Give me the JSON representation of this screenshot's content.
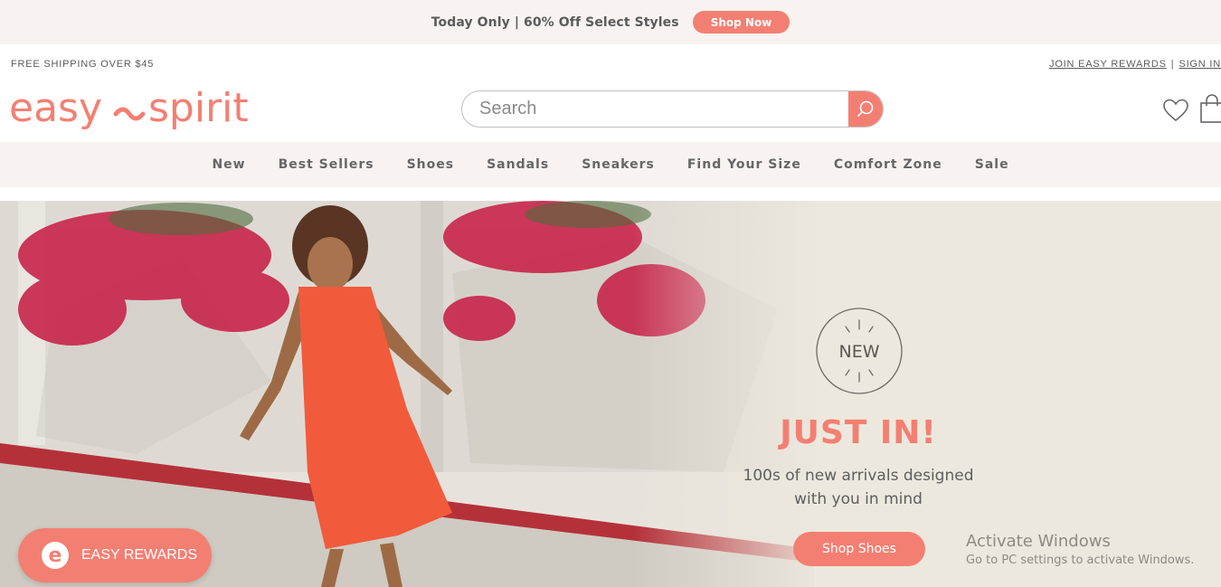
{
  "promo": {
    "text": "Today Only | 60% Off Select Styles",
    "cta": "Shop Now"
  },
  "utility": {
    "left": "FREE SHIPPING OVER $45",
    "join": "JOIN EASY REWARDS",
    "separator": "|",
    "signin": "SIGN IN"
  },
  "logo": {
    "text_left": "easy",
    "text_right": "spirit"
  },
  "search": {
    "placeholder": "Search"
  },
  "icons": {
    "search": "search-icon",
    "wishlist": "heart-icon",
    "cart": "shopping-bag-icon",
    "rewards": "easy-rewards-e-icon"
  },
  "nav": {
    "items": [
      "New",
      "Best Sellers",
      "Shoes",
      "Sandals",
      "Sneakers",
      "Find Your Size",
      "Comfort Zone",
      "Sale"
    ]
  },
  "hero": {
    "badge": "NEW",
    "headline": "JUST IN!",
    "subline1": "100s of new arrivals designed",
    "subline2": "with you in mind",
    "cta": "Shop Shoes"
  },
  "rewards_widget": {
    "label": "EASY REWARDS"
  },
  "watermark": {
    "title": "Activate Windows",
    "subtitle": "Go to PC settings to activate Windows."
  },
  "colors": {
    "accent": "#f37f72",
    "bar_bg": "#f8f3f1",
    "hero_bg": "#ede8dd",
    "text": "#5b5b5b"
  }
}
